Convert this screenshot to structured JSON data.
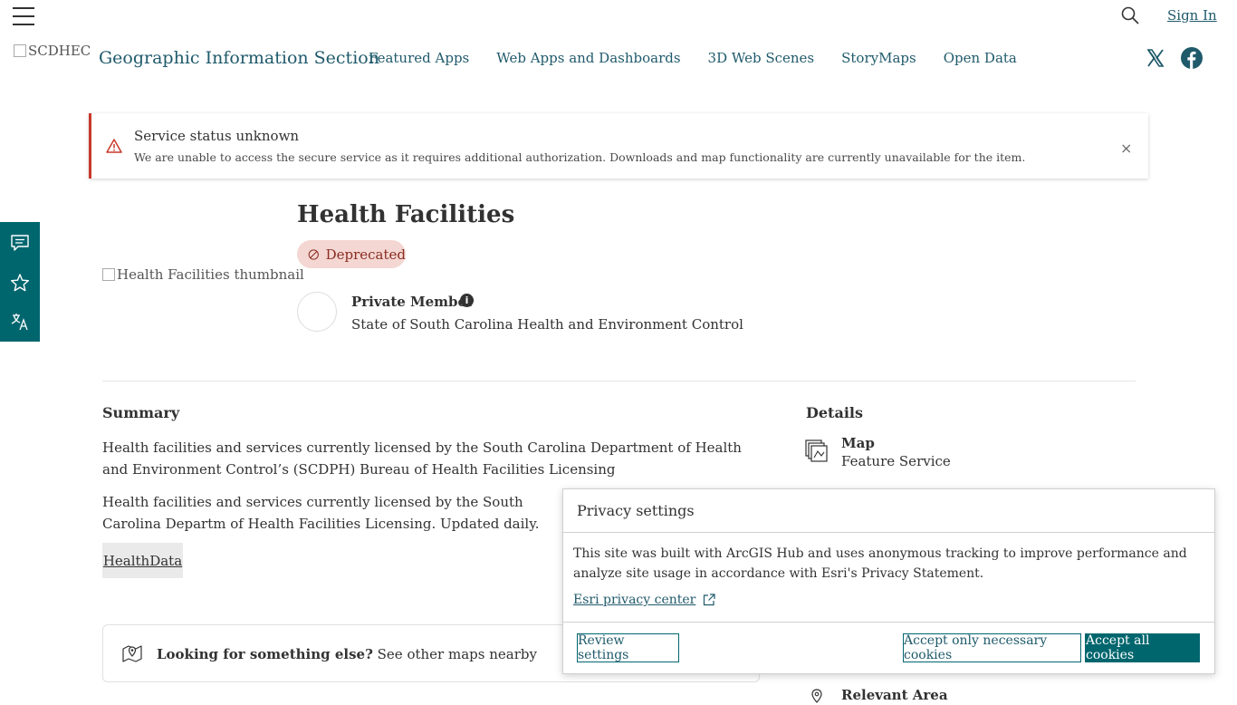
{
  "header": {
    "sign_in": "Sign In",
    "logo_alt": "SCDHEC",
    "site_title": "Geographic Information Section",
    "nav": [
      "Featured Apps",
      "Web Apps and Dashboards",
      "3D Web Scenes",
      "StoryMaps",
      "Open Data"
    ]
  },
  "alert": {
    "title": "Service status unknown",
    "message": "We are unable to access the secure service as it requires additional authorization. Downloads and map functionality are currently unavailable for the item.",
    "close": "×"
  },
  "item": {
    "thumbnail_alt": "Health Facilities thumbnail",
    "title": "Health Facilities",
    "badge": "Deprecated",
    "owner": "Private Member",
    "info": "i",
    "organization": "State of South Carolina Health and Environment Control"
  },
  "summary": {
    "heading": "Summary",
    "p1": "Health facilities and services currently licensed by the South Carolina Department of Health and Environment Control’s (SCDPH) Bureau of Health Facilities Licensing",
    "p2": "Health facilities and services currently licensed by the South Carolina Departm of Health Facilities Licensing. Updated daily.",
    "tag": "HealthData"
  },
  "looking": {
    "bold": "Looking for something else?",
    "rest": " See other maps nearby"
  },
  "details": {
    "heading": "Details",
    "type": "Map",
    "subtype": "Feature Service",
    "relevant": "Relevant Area"
  },
  "privacy": {
    "title": "Privacy settings",
    "text": "This site was built with ArcGIS Hub and uses anonymous tracking to improve performance and analyze site usage in accordance with Esri's Privacy Statement.",
    "link": "Esri privacy center",
    "review": "Review settings",
    "necessary": "Accept only necessary cookies",
    "all": "Accept all cookies"
  },
  "colors": {
    "accent": "#00666e",
    "link": "#1f5a6b",
    "alert": "#c8392b",
    "badge_bg": "#f4d7d2"
  }
}
